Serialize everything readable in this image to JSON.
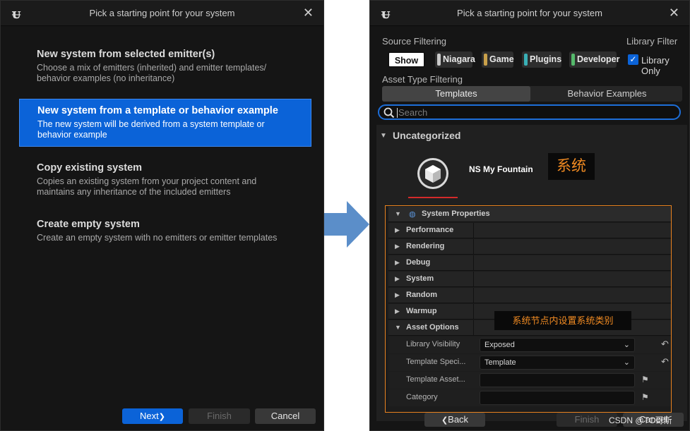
{
  "dialog_title": "Pick a starting point for your system",
  "left": {
    "options": [
      {
        "title": "New system from selected emitter(s)",
        "desc": "Choose a mix of emitters (inherited) and emitter templates/ behavior examples (no inheritance)"
      },
      {
        "title": "New system from a template or behavior example",
        "desc": "The new system will be derived from a system template or behavior example"
      },
      {
        "title": "Copy existing system",
        "desc": "Copies an existing system from your project content and maintains any inheritance of the included emitters"
      },
      {
        "title": "Create empty system",
        "desc": "Create an empty system with no emitters or emitter templates"
      }
    ],
    "selected_index": 1,
    "buttons": {
      "next": "Next",
      "next_glyph": "❯",
      "finish": "Finish",
      "cancel": "Cancel"
    }
  },
  "right": {
    "source_filtering_label": "Source Filtering",
    "library_filter_label": "Library Filter",
    "source_chips": [
      {
        "label": "Show all",
        "color": "#ffffff"
      },
      {
        "label": "Niagara",
        "color": "#c9c9c9"
      },
      {
        "label": "Game",
        "color": "#c9a04a"
      },
      {
        "label": "Plugins",
        "color": "#39b0b6"
      },
      {
        "label": "Developer",
        "color": "#55b96b"
      }
    ],
    "library_only_label": "Library Only",
    "library_only_checked": true,
    "asset_type_label": "Asset Type Filtering",
    "tabs": [
      "Templates",
      "Behavior Examples"
    ],
    "active_tab": 0,
    "search_placeholder": "Search",
    "category": "Uncategorized",
    "asset_name": "NS My Fountain",
    "annotation_system": "系统",
    "properties": {
      "section": "System Properties",
      "groups": [
        "Performance",
        "Rendering",
        "Debug",
        "System",
        "Random",
        "Warmup",
        "Asset Options"
      ],
      "asset_options": [
        {
          "label": "Library Visibility",
          "value": "Exposed",
          "type": "dropdown"
        },
        {
          "label": "Template Speci...",
          "value": "Template",
          "type": "dropdown"
        },
        {
          "label": "Template Asset...",
          "value": "",
          "type": "text"
        },
        {
          "label": "Category",
          "value": "",
          "type": "text"
        }
      ]
    },
    "annotation_settings": "系统节点内设置系统类别",
    "buttons": {
      "back_glyph": "❮",
      "back": "Back",
      "finish": "Finish",
      "cancel": "Cancel"
    },
    "watermark": "CSDN @TC哥斯"
  },
  "colors": {
    "accent": "#0b63d8",
    "annotation_text": "#f08a22",
    "annotation_border": "#e8821f",
    "underline_red": "#d42a2a",
    "arrow": "#5b8ec9"
  }
}
